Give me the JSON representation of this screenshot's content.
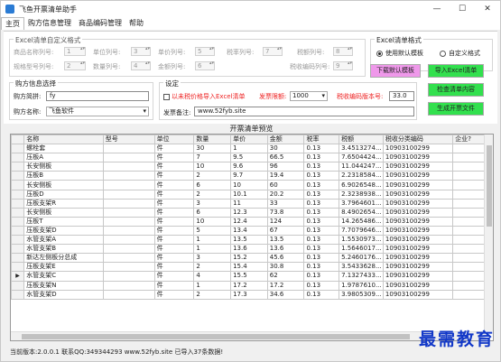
{
  "window": {
    "title": "飞鱼开票清单助手",
    "minimize": "—",
    "maximize": "☐",
    "close": "✕"
  },
  "menu": [
    "主页",
    "购方信息管理",
    "商品编码管理",
    "帮助"
  ],
  "excel_format": {
    "title": "Excel清单自定义格式",
    "fields": [
      {
        "label": "商品名称列号:",
        "value": "1"
      },
      {
        "label": "单位列号:",
        "value": "3"
      },
      {
        "label": "单价列号:",
        "value": "5"
      },
      {
        "label": "税率列号:",
        "value": "7"
      },
      {
        "label": "税额列号:",
        "value": "8"
      },
      {
        "label": "规格型号列号:",
        "value": "2"
      },
      {
        "label": "数量列号:",
        "value": "4"
      },
      {
        "label": "金额列号:",
        "value": "6"
      },
      {
        "label": "税收编码列号:",
        "value": "9"
      }
    ]
  },
  "template": {
    "title": "Excel清单格式",
    "opt_default": "使用默认模板",
    "opt_custom": "自定义格式",
    "download_btn": "下载默认模板",
    "import_btn": "导入Excel清单",
    "check_btn": "检查清单内容",
    "generate_btn": "生成开票文件"
  },
  "buyer": {
    "title": "购方信息选择",
    "short_label": "购方简拼:",
    "short_value": "fy",
    "name_label": "购方名称:",
    "name_value": "飞鱼软件"
  },
  "settings": {
    "title": "设定",
    "split_check": "以未税价格导入Excel清单",
    "limit_label": "发票限额:",
    "limit_value": "1000",
    "tax_label": "税收编码版本号:",
    "tax_value": "33.0",
    "remark_label": "发票备注:",
    "remark_value": "www.52fyb.site"
  },
  "grid": {
    "title": "开票清单预览",
    "columns": [
      "名称",
      "型号",
      "单位",
      "数量",
      "单价",
      "金额",
      "税率",
      "税额",
      "税收分类编码",
      "企业?"
    ],
    "rows": [
      [
        "螺栓套",
        "",
        "件",
        "30",
        "1",
        "30",
        "0.13",
        "3.4513274...",
        "10903100299",
        ""
      ],
      [
        "压板A",
        "",
        "件",
        "7",
        "9.5",
        "66.5",
        "0.13",
        "7.6504424...",
        "10903100299",
        ""
      ],
      [
        "长安侧板",
        "",
        "件",
        "10",
        "9.6",
        "96",
        "0.13",
        "11.044247...",
        "10903100299",
        ""
      ],
      [
        "压板B",
        "",
        "件",
        "2",
        "9.7",
        "19.4",
        "0.13",
        "2.2318584...",
        "10903100299",
        ""
      ],
      [
        "长安侧板",
        "",
        "件",
        "6",
        "10",
        "60",
        "0.13",
        "6.9026548...",
        "10903100299",
        ""
      ],
      [
        "压板D",
        "",
        "件",
        "2",
        "10.1",
        "20.2",
        "0.13",
        "2.3238938...",
        "10903100299",
        ""
      ],
      [
        "压板支架R",
        "",
        "件",
        "3",
        "11",
        "33",
        "0.13",
        "3.7964601...",
        "10903100299",
        ""
      ],
      [
        "长安侧板",
        "",
        "件",
        "6",
        "12.3",
        "73.8",
        "0.13",
        "8.4902654...",
        "10903100299",
        ""
      ],
      [
        "压板T",
        "",
        "件",
        "10",
        "12.4",
        "124",
        "0.13",
        "14.265486...",
        "10903100299",
        ""
      ],
      [
        "压板支架D",
        "",
        "件",
        "5",
        "13.4",
        "67",
        "0.13",
        "7.7079646...",
        "10903100299",
        ""
      ],
      [
        "水管支架A",
        "",
        "件",
        "1",
        "13.5",
        "13.5",
        "0.13",
        "1.5530973...",
        "10903100299",
        ""
      ],
      [
        "水管支架B",
        "",
        "件",
        "1",
        "13.6",
        "13.6",
        "0.13",
        "1.5646017...",
        "10903100299",
        ""
      ],
      [
        "新达左侧板分总成",
        "",
        "件",
        "3",
        "15.2",
        "45.6",
        "0.13",
        "5.2460176...",
        "10903100299",
        ""
      ],
      [
        "压板支架E",
        "",
        "件",
        "2",
        "15.4",
        "30.8",
        "0.13",
        "3.5433628...",
        "10903100299",
        ""
      ],
      [
        "水管支架C",
        "",
        "件",
        "4",
        "15.5",
        "62",
        "0.13",
        "7.1327433...",
        "10903100299",
        ""
      ],
      [
        "压板支架N",
        "",
        "件",
        "1",
        "17.2",
        "17.2",
        "0.13",
        "1.9787610...",
        "10903100299",
        ""
      ],
      [
        "水管支架D",
        "",
        "件",
        "2",
        "17.3",
        "34.6",
        "0.13",
        "3.9805309...",
        "10903100299",
        ""
      ]
    ],
    "current_row": 14
  },
  "status": "当前版本:2.0.0.1  联系QQ:349344293   www.52fyb.site 已导入37条数据!",
  "watermark": "最需教育"
}
